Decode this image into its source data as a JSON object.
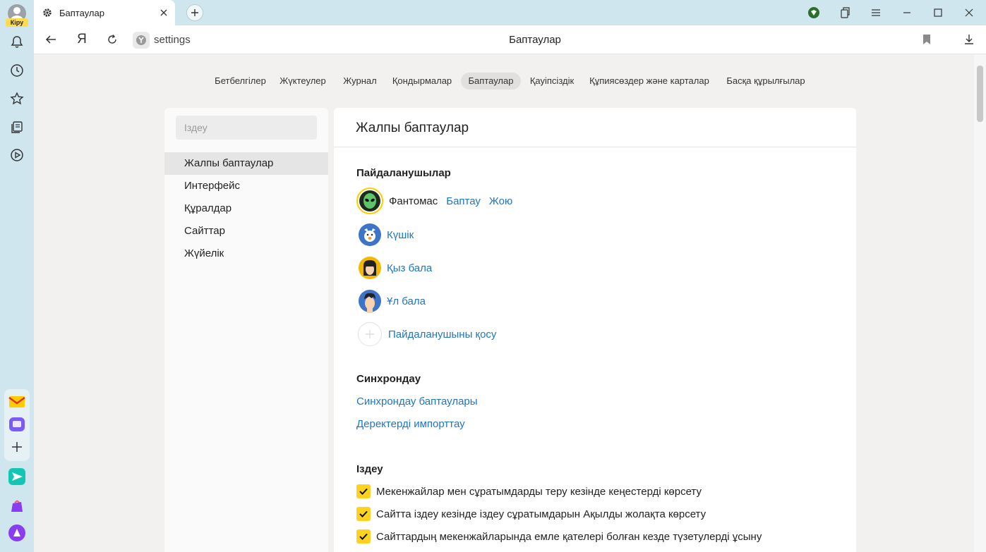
{
  "sidebar": {
    "login_label": "Кіру",
    "icons": [
      "notifications-icon",
      "history-icon",
      "bookmarks-icon",
      "collections-icon",
      "media-icon"
    ],
    "apps": [
      "mail-app-icon",
      "messenger-app-icon",
      "add-app-icon",
      "send-app-icon",
      "market-app-icon",
      "alice-app-icon"
    ]
  },
  "tabbar": {
    "active_tab_title": "Баптаулар"
  },
  "addressbar": {
    "back_label": "←",
    "yandex_label": "Я",
    "url": "settings",
    "page_title": "Баптаулар"
  },
  "topnav": {
    "items": [
      {
        "label": "Бетбелгілер"
      },
      {
        "label": "Жүктеулер"
      },
      {
        "label": "Журнал"
      },
      {
        "label": "Қондырмалар"
      },
      {
        "label": "Баптаулар"
      },
      {
        "label": "Қауіпсіздік"
      },
      {
        "label": "Құпиясөздер және карталар"
      },
      {
        "label": "Басқа құрылғылар"
      }
    ],
    "active_index": 4
  },
  "leftpanel": {
    "search_placeholder": "Іздеу",
    "items": [
      {
        "label": "Жалпы баптаулар"
      },
      {
        "label": "Интерфейс"
      },
      {
        "label": "Құралдар"
      },
      {
        "label": "Сайттар"
      },
      {
        "label": "Жүйелік"
      }
    ],
    "active_index": 0
  },
  "main": {
    "title": "Жалпы баптаулар",
    "users": {
      "section_title": "Пайдаланушылар",
      "current_user": {
        "name": "Фантомас",
        "settings_link": "Баптау",
        "delete_link": "Жою"
      },
      "profiles": [
        {
          "label": "Күшік"
        },
        {
          "label": "Қыз бала"
        },
        {
          "label": "Ұл бала"
        }
      ],
      "add_user_label": "Пайдаланушыны қосу"
    },
    "sync": {
      "section_title": "Синхрондау",
      "settings_link": "Синхрондау баптаулары",
      "import_link": "Деректерді импорттау"
    },
    "search": {
      "section_title": "Іздеу",
      "options": [
        {
          "label": "Мекенжайлар мен сұратымдарды теру кезінде кеңестерді көрсету",
          "checked": true
        },
        {
          "label": "Сайтта іздеу кезінде іздеу сұратымдарын Ақылды жолақта көрсету",
          "checked": true
        },
        {
          "label": "Сайттардың мекенжайларында емле қателері болған кезде түзетулерді ұсыну",
          "checked": true
        }
      ]
    }
  },
  "colors": {
    "accent_yellow": "#ffd21f",
    "link_blue": "#1e75c4",
    "sidebar_bg": "#cfe6ee"
  }
}
